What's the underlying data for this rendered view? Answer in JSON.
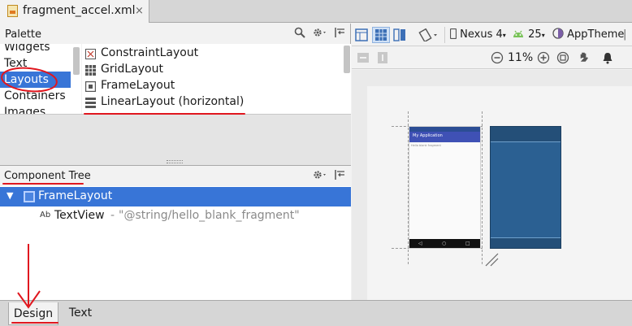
{
  "editor": {
    "file_tab_label": "fragment_accel.xml",
    "close_glyph": "×"
  },
  "palette": {
    "title": "Palette",
    "categories": [
      "Widgets",
      "Text",
      "Layouts",
      "Containers",
      "Images"
    ],
    "selected_category": "Layouts",
    "items": [
      "ConstraintLayout",
      "GridLayout",
      "FrameLayout",
      "LinearLayout (horizontal)"
    ]
  },
  "component_tree": {
    "title": "Component Tree",
    "root_label": "FrameLayout",
    "child_icon_text": "Ab",
    "child_label": "TextView",
    "child_separator": "-",
    "child_value": "\"@string/hello_blank_fragment\""
  },
  "toolbar": {
    "device": "Nexus 4",
    "api_level": "25",
    "theme": "AppTheme",
    "zoom": "11%"
  },
  "preview": {
    "app_title": "My Application",
    "content_text": "Hello blank fragment"
  },
  "bottom_tabs": {
    "design": "Design",
    "text": "Text"
  },
  "colors": {
    "selection": "#3875d7",
    "annotation": "#e0171f",
    "blueprint": "#2b6092",
    "appbar": "#3f51b5"
  },
  "icons": [
    "file-xml-icon",
    "search-icon",
    "gear-icon",
    "collapse-icon",
    "design-view-icon",
    "blueprint-view-icon",
    "both-views-icon",
    "rotate-icon",
    "device-icon",
    "android-api-icon",
    "theme-icon",
    "zoom-out-icon",
    "zoom-in-icon",
    "zoom-fit-icon",
    "pan-icon",
    "warning-icon"
  ]
}
